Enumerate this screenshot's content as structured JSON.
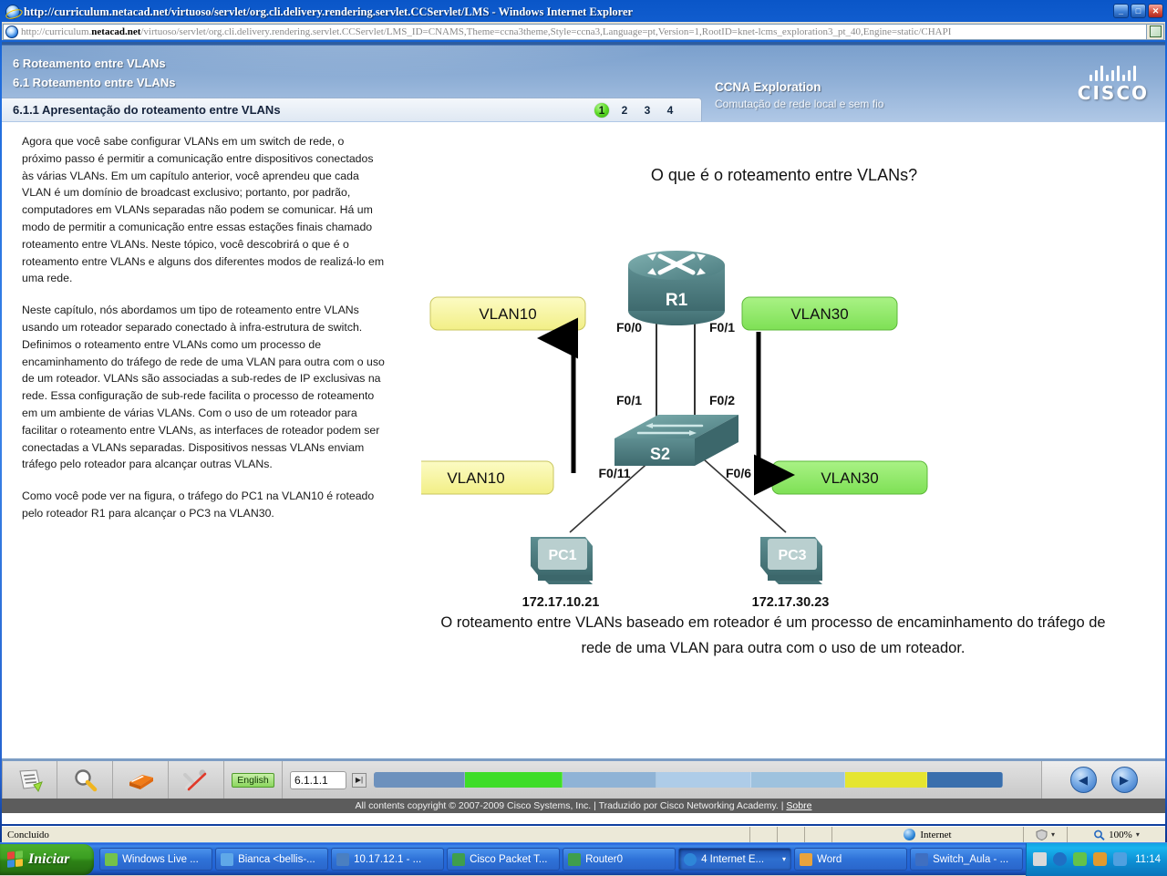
{
  "browser": {
    "title": "http://curriculum.netacad.net/virtuoso/servlet/org.cli.delivery.rendering.servlet.CCServlet/LMS - Windows Internet Explorer",
    "url_prefix": "http://curriculum.",
    "url_domain": "netacad.net",
    "url_suffix": "/virtuoso/servlet/org.cli.delivery.rendering.servlet.CCServlet/LMS_ID=CNAMS,Theme=ccna3theme,Style=ccna3,Language=pt,Version=1,RootID=knet-lcms_exploration3_pt_40,Engine=static/CHAPI",
    "minimize_label": "_",
    "maximize_label": "□",
    "close_label": "✕",
    "go_button_name": "go-button"
  },
  "course": {
    "breadcrumb_1": "6 Roteamento entre VLANs",
    "breadcrumb_2": "6.1 Roteamento entre VLANs",
    "topic_title": "6.1.1 Apresentação do roteamento entre VLANs",
    "pages": [
      "1",
      "2",
      "3",
      "4"
    ],
    "active_page": "1",
    "brand_title": "CCNA Exploration",
    "brand_subtitle": "Comutação de rede local e sem fio",
    "logo_text": "CISCO"
  },
  "lesson": {
    "paragraphs": [
      "Agora que você sabe configurar VLANs em um switch de rede, o próximo passo é permitir a comunicação entre dispositivos conectados às várias VLANs. Em um capítulo anterior, você aprendeu que cada VLAN é um domínio de broadcast exclusivo; portanto, por padrão, computadores em VLANs separadas não podem se comunicar. Há um modo de permitir a comunicação entre essas estações finais chamado roteamento entre VLANs. Neste tópico, você descobrirá o que é o roteamento entre VLANs e alguns dos diferentes modos de realizá-lo em uma rede.",
      "Neste capítulo, nós abordamos um tipo de roteamento entre VLANs usando um roteador separado conectado à infra-estrutura de switch. Definimos o roteamento entre VLANs como um processo de encaminhamento do tráfego de rede de uma VLAN para outra com o uso de um roteador. VLANs são associadas a sub-redes de IP exclusivas na rede. Essa configuração de sub-rede facilita o processo de roteamento em um ambiente de várias VLANs. Com o uso de um roteador para facilitar o roteamento entre VLANs, as interfaces de roteador podem ser conectadas a VLANs separadas. Dispositivos nessas VLANs enviam tráfego pelo roteador para alcançar outras VLANs.",
      "Como você pode ver na figura, o tráfego do PC1 na VLAN10 é roteado pelo roteador R1 para alcançar o PC3 na VLAN30."
    ],
    "figure_title": "O que é o roteamento entre VLANs?",
    "caption": "O roteamento entre VLANs baseado em roteador é um processo de encaminhamento do tráfego de rede de uma VLAN para outra com o uso de um roteador."
  },
  "diagram": {
    "router_label": "R1",
    "switch_label": "S2",
    "pc1_label": "PC1",
    "pc3_label": "PC3",
    "pc1_ip": "172.17.10.21",
    "pc3_ip": "172.17.30.23",
    "router_port_left": "F0/0",
    "router_port_right": "F0/1",
    "switch_port_uplink_left": "F0/1",
    "switch_port_uplink_right": "F0/2",
    "switch_port_pc1": "F0/11",
    "switch_port_pc3": "F0/6",
    "vlan_top_left": "VLAN10",
    "vlan_top_right": "VLAN30",
    "vlan_bottom_left": "VLAN10",
    "vlan_bottom_right": "VLAN30",
    "color_vlan10": "#f7f59a",
    "color_vlan30": "#8ee868",
    "color_device": "#57878a"
  },
  "toolbar": {
    "notes_icon": "notes-icon",
    "search_icon": "magnifier-icon",
    "glossary_icon": "book-icon",
    "tools_icon": "tools-icon",
    "language": "English",
    "page_number": "6.1.1.1",
    "next_icon": "▶|",
    "prev_nav_icon": "◀",
    "next_nav_icon": "▶",
    "progress_segments": [
      {
        "color": "#6d91bd",
        "width": 14.5
      },
      {
        "color": "#3fdd28",
        "width": 15.5
      },
      {
        "color": "#8fb3d6",
        "width": 15.0
      },
      {
        "color": "#aecce8",
        "width": 15.0
      },
      {
        "color": "#9ec2de",
        "width": 15.0
      },
      {
        "color": "#e5e530",
        "width": 13.0
      },
      {
        "color": "#3a6fad",
        "width": 12.0
      }
    ],
    "copyright": "All contents copyright © 2007-2009 Cisco Systems, Inc. | Traduzido por Cisco Networking Academy. |",
    "about_link": "Sobre"
  },
  "statusbar": {
    "status": "Concluído",
    "zone": "Internet",
    "zoom": "100%",
    "caret": "▾"
  },
  "taskbar": {
    "start_label": "Iniciar",
    "items": [
      {
        "label": "Windows Live ...",
        "icon_color": "#74c24a",
        "active": false,
        "caret": ""
      },
      {
        "label": "Bianca <bellis-...",
        "icon_color": "#5fa8e8",
        "active": false,
        "caret": ""
      },
      {
        "label": "10.17.12.1 - ...",
        "icon_color": "#4a7fc1",
        "active": false,
        "caret": ""
      },
      {
        "label": "Cisco Packet T...",
        "icon_color": "#3f9e4d",
        "active": false,
        "caret": ""
      },
      {
        "label": "Router0",
        "icon_color": "#3f9e4d",
        "active": false,
        "caret": ""
      },
      {
        "label": "4 Internet E...",
        "icon_color": "#2e86d8",
        "active": true,
        "caret": "▾"
      },
      {
        "label": "Word",
        "icon_color": "#e8a33d",
        "active": false,
        "caret": ""
      },
      {
        "label": "Switch_Aula - ...",
        "icon_color": "#3f6fc1",
        "active": false,
        "caret": ""
      }
    ],
    "clock": "11:14"
  }
}
